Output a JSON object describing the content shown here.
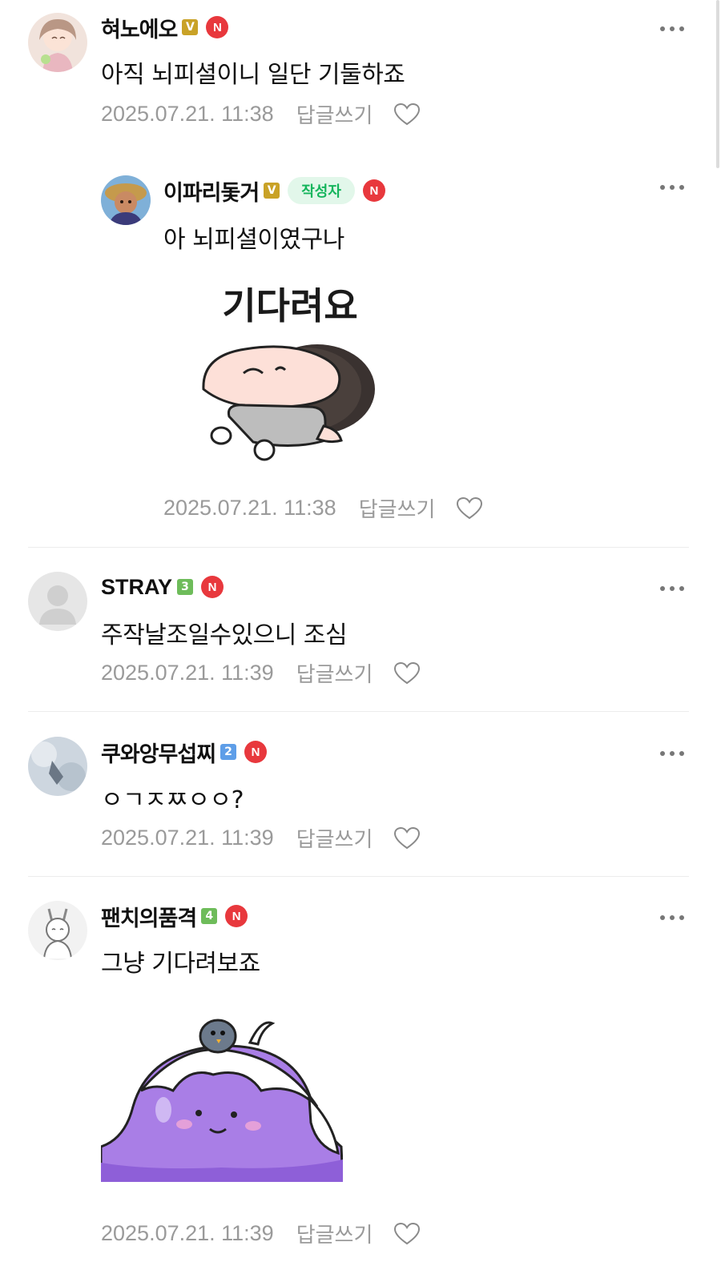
{
  "comments": [
    {
      "nickname": "혀노에오",
      "level_badge": "V",
      "new_badge": "N",
      "text": "아직 뇌피셜이니 일단 기둘하죠",
      "date": "2025.07.21. 11:38",
      "reply_label": "답글쓰기"
    },
    {
      "nickname": "이파리돛거",
      "level_badge": "V",
      "author_badge": "작성자",
      "new_badge": "N",
      "text": "아 뇌피셜이였구나",
      "sticker_text": "기다려요",
      "date": "2025.07.21. 11:38",
      "reply_label": "답글쓰기"
    },
    {
      "nickname": "STRAY",
      "level_badge": "3",
      "new_badge": "N",
      "text": "주작날조일수있으니 조심",
      "date": "2025.07.21. 11:39",
      "reply_label": "답글쓰기"
    },
    {
      "nickname": "쿠와앙무섭찌",
      "level_badge": "2",
      "new_badge": "N",
      "text": "ㅇㄱㅈㅉㅇㅇ?",
      "date": "2025.07.21. 11:39",
      "reply_label": "답글쓰기"
    },
    {
      "nickname": "팬치의품격",
      "level_badge": "4",
      "new_badge": "N",
      "text": "그냥 기다려보죠",
      "date": "2025.07.21. 11:39",
      "reply_label": "답글쓰기"
    }
  ],
  "colors": {
    "level_v": "#c9a227",
    "level_3": "#6ebc5a",
    "level_2": "#5e9ee8",
    "level_4": "#6ebc5a",
    "new_badge": "#e8383d",
    "author_badge_bg": "#e2f7ea",
    "author_badge_text": "#15b55c",
    "meta_text": "#9a9a9a"
  },
  "icons": [
    "more-icon",
    "heart-icon",
    "new-badge-icon"
  ]
}
